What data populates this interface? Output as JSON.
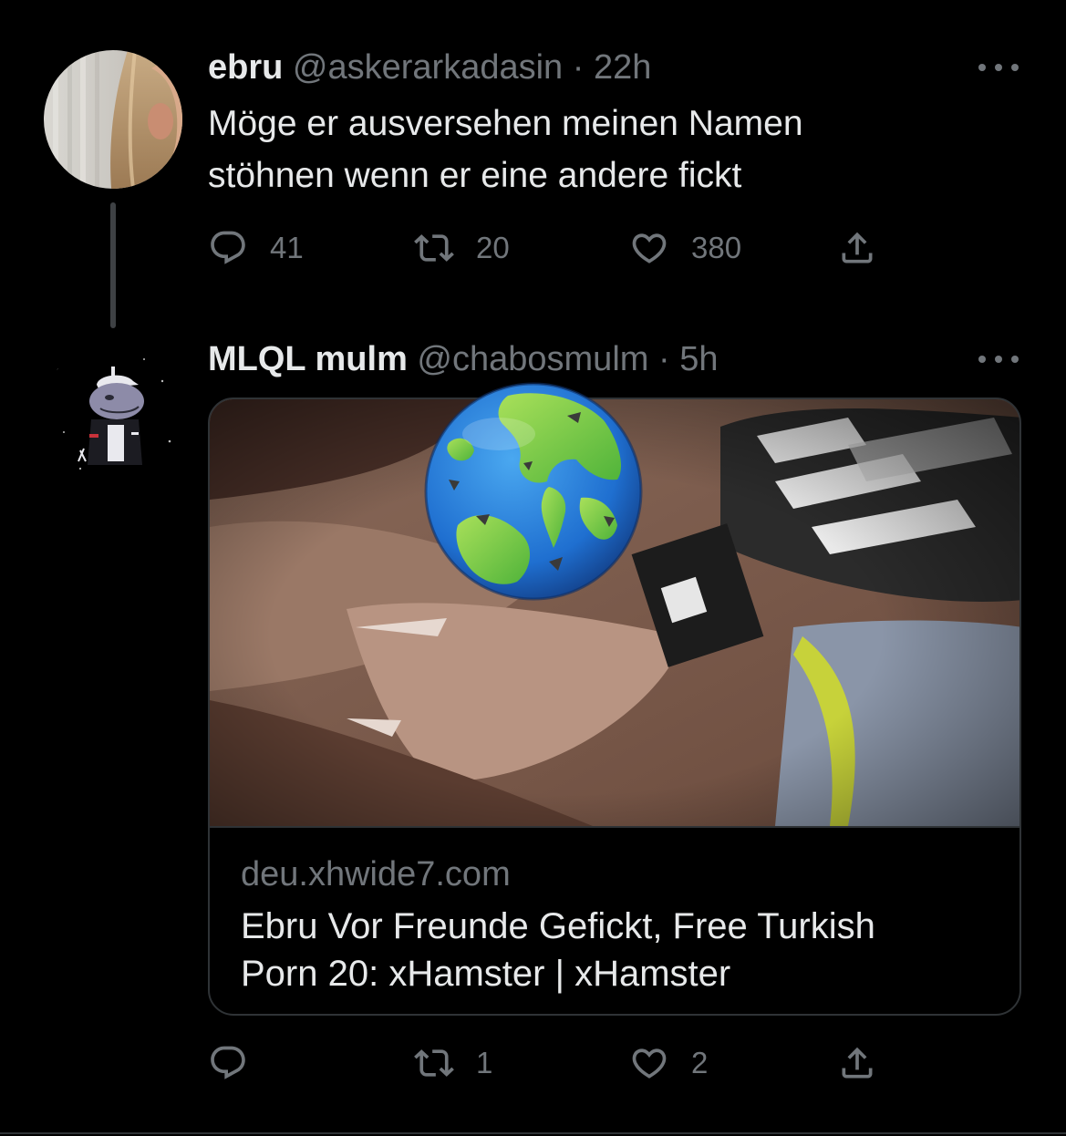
{
  "tweet1": {
    "name": "ebru",
    "handle": "@askerarkadasin",
    "dot": "·",
    "time": "22h",
    "text_line1": "Möge er ausversehen meinen Namen",
    "text_line2": "stöhnen wenn er eine andere fickt",
    "replies": "41",
    "retweets": "20",
    "likes": "380",
    "avatar_icon": "profile-photo"
  },
  "tweet2": {
    "name": "MLQL mulm",
    "handle": "@chabosmulm",
    "dot": "·",
    "time": "5h",
    "replies": "",
    "retweets": "1",
    "likes": "2",
    "avatar_icon": "cartoon-character-avatar",
    "card": {
      "domain": "deu.xhwide7.com",
      "title_line1": "Ebru Vor Freunde Gefickt, Free Turkish",
      "title_line2": "Porn 20: xHamster | xHamster",
      "media_icon": "obscured-video-thumbnail",
      "overlay_icon": "globe-emoji"
    }
  },
  "icons": {
    "reply": "reply-icon",
    "retweet": "retweet-icon",
    "like": "heart-icon",
    "share": "share-icon",
    "more": "more-icon"
  },
  "colors": {
    "background": "#000000",
    "text_primary": "#e7e9ea",
    "text_secondary": "#71767b",
    "border": "#2f3336"
  }
}
